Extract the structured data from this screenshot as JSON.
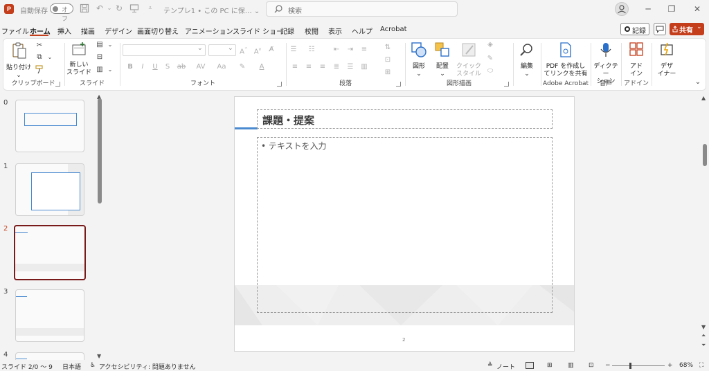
{
  "titlebar": {
    "app_logo": "P",
    "autosave_label": "自動保存",
    "autosave_toggle": "オフ",
    "doc_title": "テンプレ1 • この PC に保… ⌄",
    "search_placeholder": "検索"
  },
  "menu": {
    "tabs": [
      "ファイル",
      "ホーム",
      "挿入",
      "描画",
      "デザイン",
      "画面切り替え",
      "アニメーション",
      "スライド ショー",
      "記録",
      "校閲",
      "表示",
      "ヘルプ",
      "Acrobat"
    ],
    "active_tab": "ホーム",
    "record_button": "記録",
    "share_button": "共有"
  },
  "ribbon": {
    "clipboard": {
      "paste": "貼り付け",
      "label": "クリップボード"
    },
    "slides": {
      "new_slide_line1": "新しい",
      "new_slide_line2": "スライド",
      "label": "スライド"
    },
    "font": {
      "label": "フォント"
    },
    "paragraph": {
      "label": "段落"
    },
    "drawing": {
      "shapes": "図形",
      "arrange": "配置",
      "quick_styles_line1": "クイック",
      "quick_styles_line2": "スタイル",
      "label": "図形描画"
    },
    "editing": {
      "edit": "編集"
    },
    "acrobat": {
      "pdf_line1": "PDF を作成し",
      "pdf_line2": "てリンクを共有",
      "label": "Adobe Acrobat"
    },
    "voice": {
      "dictate_line1": "ディクテー",
      "dictate_line2": "ション",
      "label": "音声"
    },
    "addins": {
      "addin_line1": "アド",
      "addin_line2": "イン",
      "label": "アドイン"
    },
    "designer": {
      "designer_line1": "デザ",
      "designer_line2": "イナー"
    }
  },
  "thumbnails": [
    {
      "number": "0"
    },
    {
      "number": "1"
    },
    {
      "number": "2"
    },
    {
      "number": "3"
    },
    {
      "number": "4"
    }
  ],
  "slide": {
    "title": "課題・提案",
    "bullet": "• テキストを入力",
    "page_number": "2"
  },
  "statusbar": {
    "slide_info": "スライド 2/0 ～ 9",
    "language": "日本語",
    "accessibility": "アクセシビリティ: 問題ありません",
    "notes": "ノート",
    "zoom": "68%"
  },
  "colors": {
    "accent": "#c43e1c",
    "selected_thumb_border": "#7a1b1b",
    "slide_accent_blue": "#4a8ad0"
  }
}
